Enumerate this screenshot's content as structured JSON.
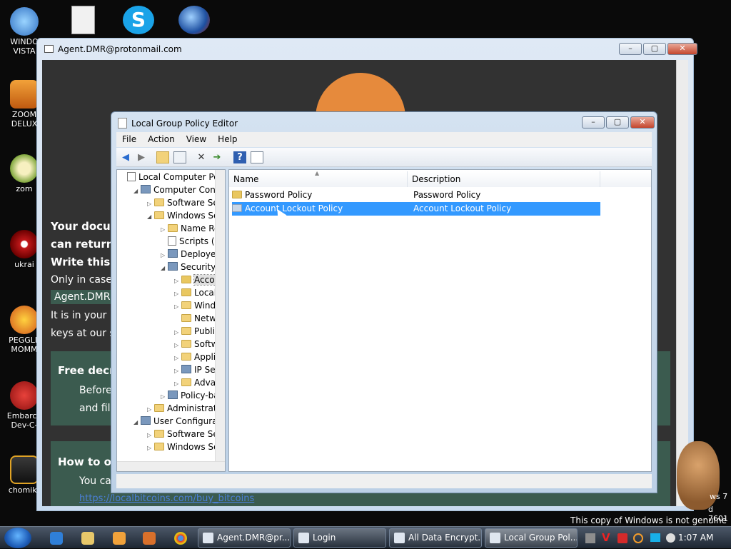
{
  "desktop": {
    "icons": [
      {
        "label": "WINDO\nVISTA",
        "icon": "windows-vista-icon"
      },
      {
        "label": "ZOOM\nDELUX",
        "icon": "zoom-deluxe-icon"
      },
      {
        "label": "zom",
        "icon": "flower-icon"
      },
      {
        "label": "ukrai",
        "icon": "radiation-icon"
      },
      {
        "label": "PEGGLE\nMOMM",
        "icon": "peggle-icon"
      },
      {
        "label": "Embarca\nDev-C-",
        "icon": "devcpp-icon"
      },
      {
        "label": "chomikr",
        "icon": "chomikuj-icon"
      }
    ],
    "top_icons": [
      "document-icon",
      "skype-icon",
      "globe-icon"
    ]
  },
  "background_window": {
    "title": "Agent.DMR@protonmail.com",
    "lines": [
      "Your docum",
      "can return a",
      "Write this I",
      "Only in case",
      "Agent.DMR@",
      "It is in your in",
      "keys at our s"
    ],
    "box1_title": "Free decry",
    "box1_lines": [
      "Before",
      "and file"
    ],
    "box2_title": "How to ob",
    "box2_line": "You ca",
    "link": "https://localbitcoins.com/buy_bitcoins"
  },
  "gpe": {
    "title": "Local Group Policy Editor",
    "menu": [
      "File",
      "Action",
      "View",
      "Help"
    ],
    "tree": [
      {
        "label": "Local Computer Polic",
        "indent": 0,
        "toggle": "",
        "icon": "doc"
      },
      {
        "label": "Computer Config",
        "indent": 1,
        "toggle": "◢",
        "icon": "comp"
      },
      {
        "label": "Software Setti",
        "indent": 2,
        "toggle": "▷",
        "icon": "fold"
      },
      {
        "label": "Windows Sett",
        "indent": 2,
        "toggle": "◢",
        "icon": "fold"
      },
      {
        "label": "Name Res",
        "indent": 3,
        "toggle": "▷",
        "icon": "fold"
      },
      {
        "label": "Scripts (Sta",
        "indent": 3,
        "toggle": "",
        "icon": "doc"
      },
      {
        "label": "Deployed",
        "indent": 3,
        "toggle": "▷",
        "icon": "comp"
      },
      {
        "label": "Security Se",
        "indent": 3,
        "toggle": "◢",
        "icon": "comp"
      },
      {
        "label": "Accou",
        "indent": 4,
        "toggle": "▷",
        "icon": "fold lock",
        "selected": true
      },
      {
        "label": "Local P",
        "indent": 4,
        "toggle": "▷",
        "icon": "fold lock"
      },
      {
        "label": "Windo",
        "indent": 4,
        "toggle": "▷",
        "icon": "fold"
      },
      {
        "label": "Netwo",
        "indent": 4,
        "toggle": "",
        "icon": "fold"
      },
      {
        "label": "Public",
        "indent": 4,
        "toggle": "▷",
        "icon": "fold"
      },
      {
        "label": "Softwa",
        "indent": 4,
        "toggle": "▷",
        "icon": "fold"
      },
      {
        "label": "Applic",
        "indent": 4,
        "toggle": "▷",
        "icon": "fold"
      },
      {
        "label": "IP Secu",
        "indent": 4,
        "toggle": "▷",
        "icon": "comp"
      },
      {
        "label": "Advan",
        "indent": 4,
        "toggle": "▷",
        "icon": "fold"
      },
      {
        "label": "Policy-bas",
        "indent": 3,
        "toggle": "▷",
        "icon": "comp"
      },
      {
        "label": "Administrativ",
        "indent": 2,
        "toggle": "▷",
        "icon": "fold"
      },
      {
        "label": "User Configuration",
        "indent": 1,
        "toggle": "◢",
        "icon": "comp"
      },
      {
        "label": "Software Setti",
        "indent": 2,
        "toggle": "▷",
        "icon": "fold"
      },
      {
        "label": "Windows Sett",
        "indent": 2,
        "toggle": "▷",
        "icon": "fold"
      }
    ],
    "columns": {
      "name": "Name",
      "description": "Description"
    },
    "rows": [
      {
        "name": "Password Policy",
        "description": "Password Policy",
        "selected": false
      },
      {
        "name": "Account Lockout Policy",
        "description": "Account Lockout Policy",
        "selected": true
      }
    ]
  },
  "taskbar": {
    "buttons": [
      {
        "label": "Agent.DMR@pr...",
        "active": false
      },
      {
        "label": "Login",
        "active": false
      },
      {
        "label": "All Data Encrypt...",
        "active": false
      },
      {
        "label": "Local Group Pol...",
        "active": true
      }
    ],
    "clock": "1:07 AM"
  },
  "watermark": {
    "genuine": "This copy of Windows is not genuine",
    "os": "ws 7",
    "build": "d 7601"
  },
  "colors": {
    "selection": "#3399ff",
    "ransom_bg": "#323232",
    "ransom_box": "#3b5b4f",
    "orange": "#e68a3c"
  }
}
